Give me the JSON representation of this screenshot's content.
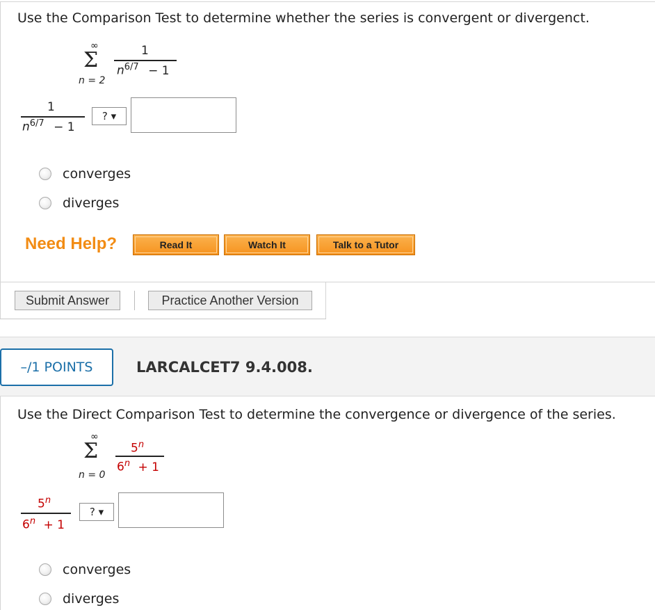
{
  "q1": {
    "prompt": "Use the Comparison Test to determine whether the series is convergent or divergenct.",
    "series": {
      "sigma": "Σ",
      "upper": "∞",
      "lower": "n = 2",
      "numerator": "1",
      "den_base": "n",
      "den_exp": "6/7",
      "den_tail": "− 1"
    },
    "compare": {
      "numerator": "1",
      "den_base": "n",
      "den_exp": "6/7",
      "den_tail": "− 1",
      "select_value": "? ▾"
    },
    "options": [
      "converges",
      "diverges"
    ],
    "help": {
      "title": "Need Help?",
      "buttons": [
        "Read It",
        "Watch It",
        "Talk to a Tutor"
      ]
    },
    "actions": {
      "submit": "Submit Answer",
      "practice": "Practice Another Version"
    }
  },
  "q2": {
    "points": "–/1 POINTS",
    "id": "LARCALCET7 9.4.008.",
    "prompt": "Use the Direct Comparison Test to determine the convergence or divergence of the series.",
    "series": {
      "sigma": "Σ",
      "upper": "∞",
      "lower": "n = 0",
      "num_base": "5",
      "num_exp": "n",
      "den_base": "6",
      "den_exp": "n",
      "den_tail": "+ 1"
    },
    "compare": {
      "num_base": "5",
      "num_exp": "n",
      "den_base": "6",
      "den_exp": "n",
      "den_tail": "+ 1",
      "select_value": "? ▾"
    },
    "options": [
      "converges",
      "diverges"
    ]
  }
}
